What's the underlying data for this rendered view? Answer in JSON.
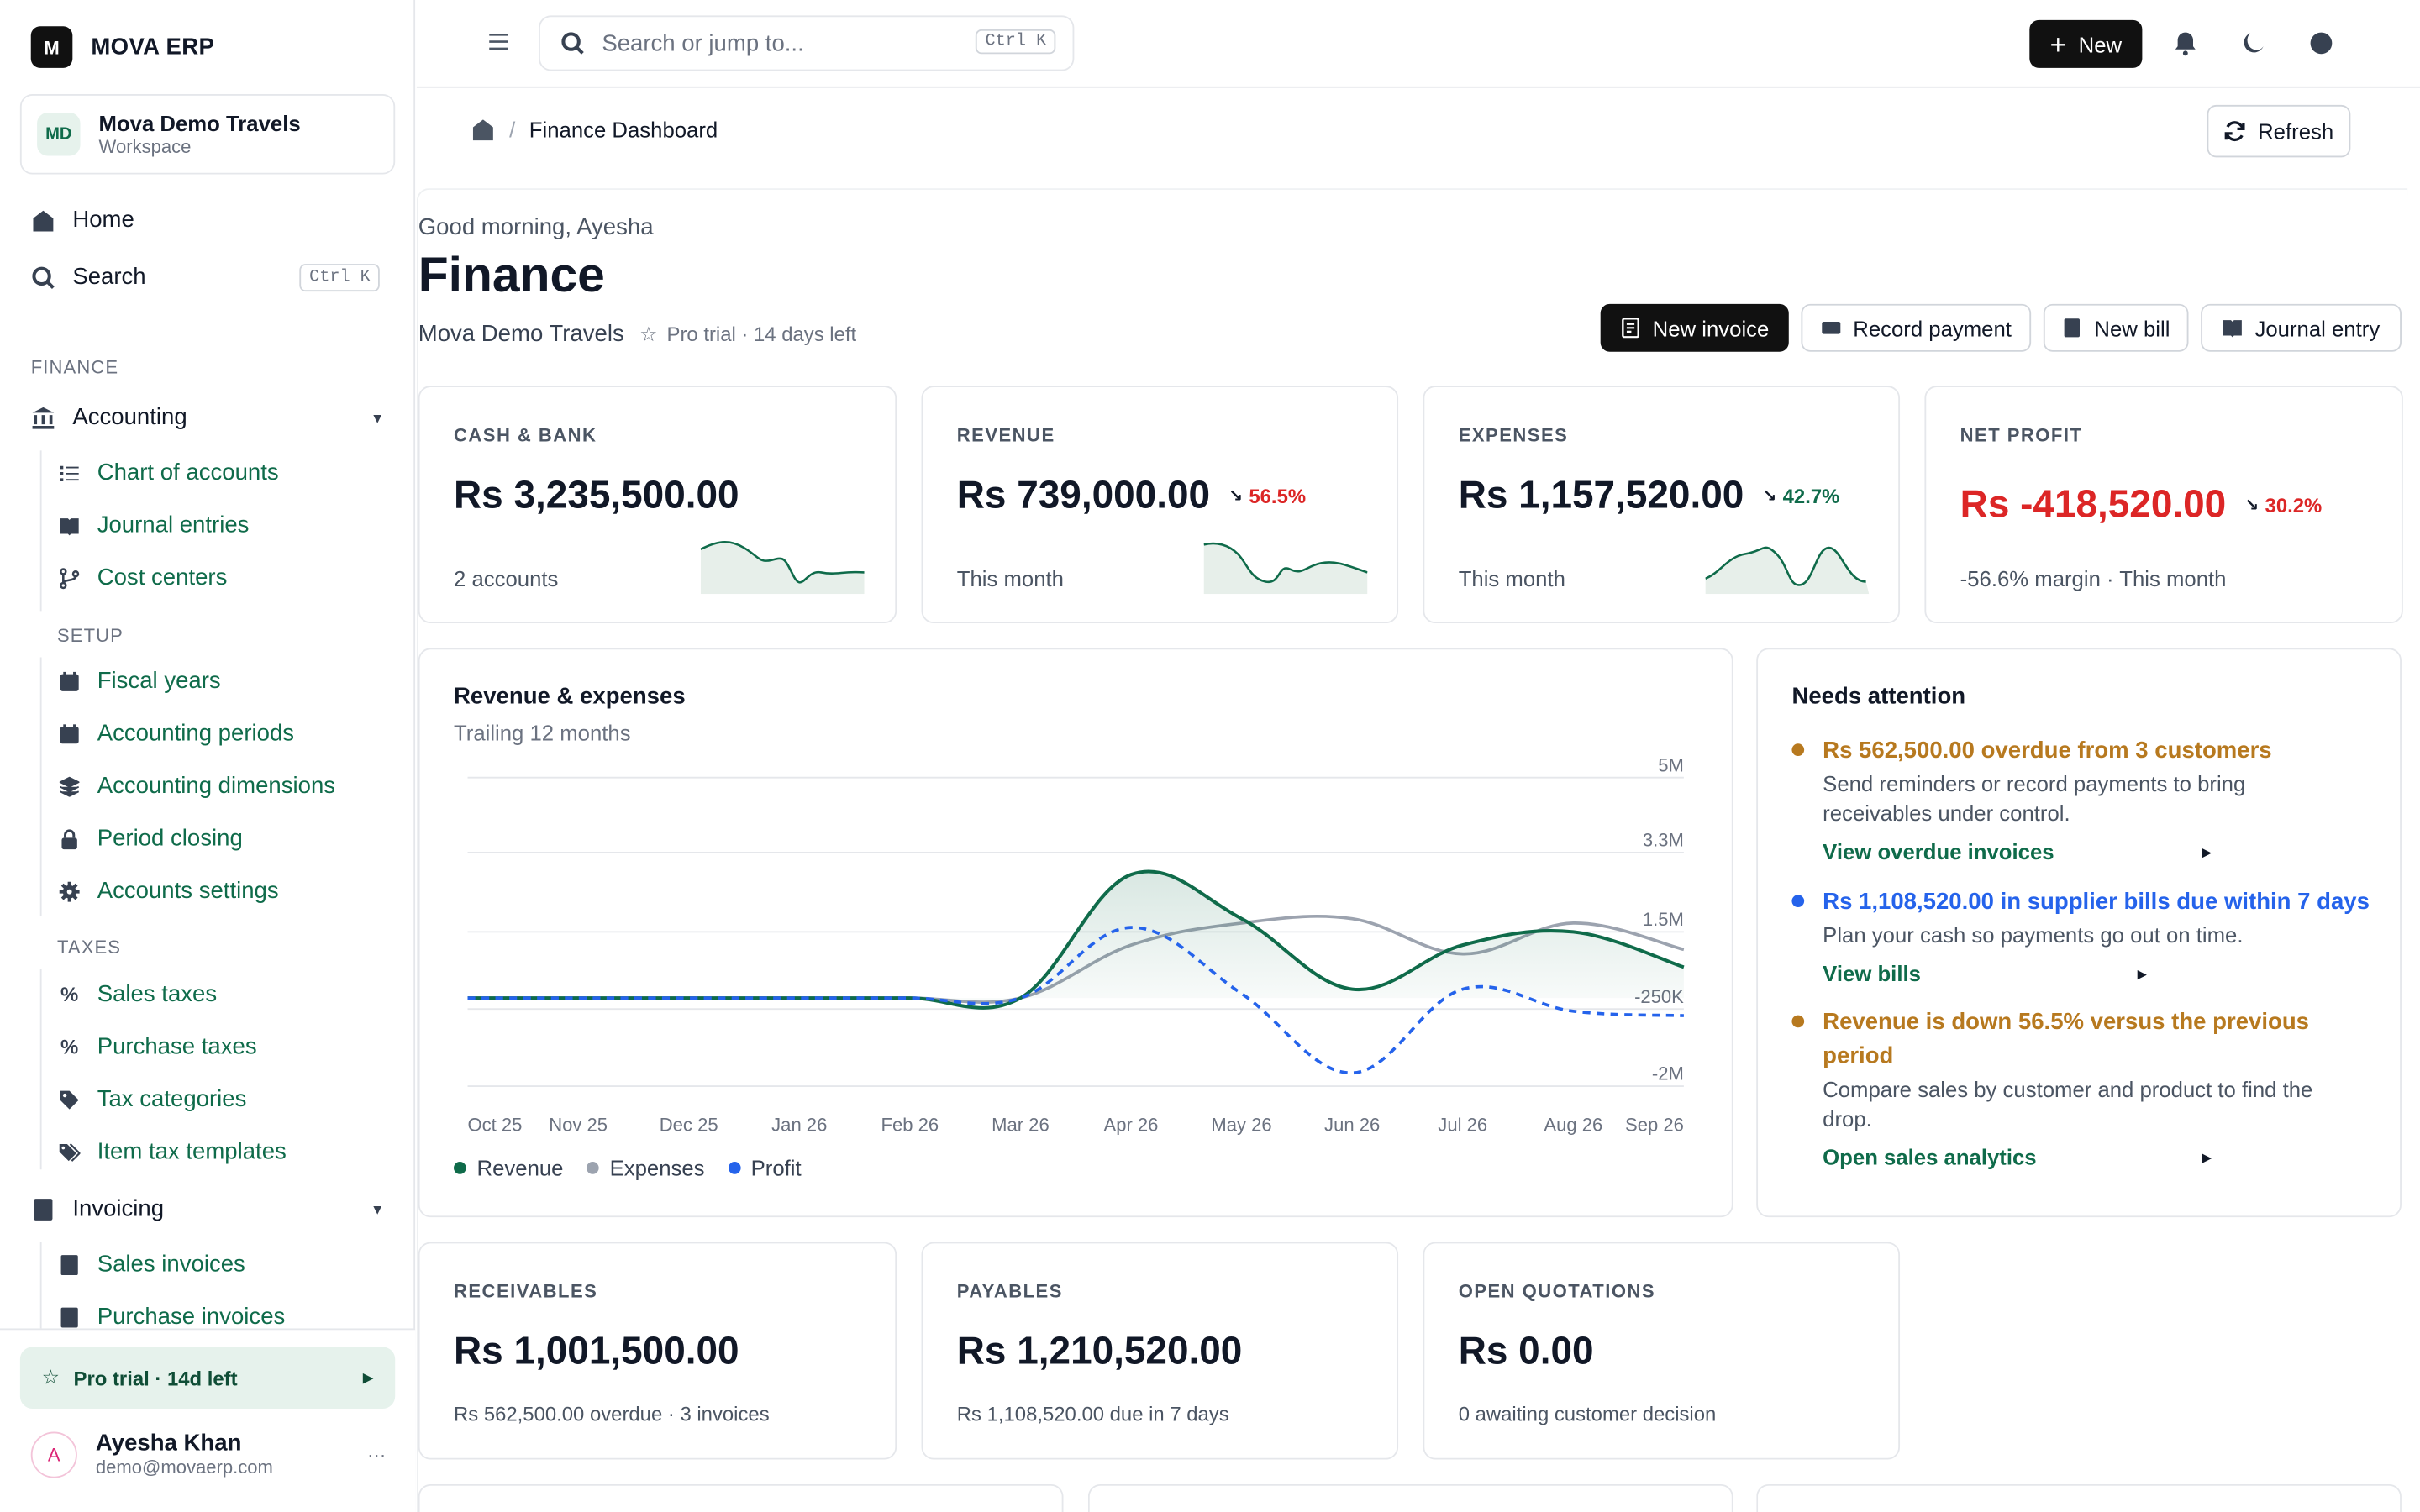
{
  "app": {
    "name": "MOVA ERP",
    "logo_letter": "M"
  },
  "workspace": {
    "initials": "MD",
    "name": "Mova Demo Travels",
    "subtitle": "Workspace"
  },
  "nav": {
    "home": "Home",
    "search": "Search",
    "search_shortcut": "Ctrl K",
    "section_finance": "FINANCE",
    "accounting": "Accounting",
    "accounting_items": [
      "Chart of accounts",
      "Journal entries",
      "Cost centers"
    ],
    "setup_label": "SETUP",
    "setup_items": [
      "Fiscal years",
      "Accounting periods",
      "Accounting dimensions",
      "Period closing",
      "Accounts settings"
    ],
    "taxes_label": "TAXES",
    "taxes_items": [
      "Sales taxes",
      "Purchase taxes",
      "Tax categories",
      "Item tax templates"
    ],
    "invoicing": "Invoicing",
    "invoicing_items": [
      "Sales invoices",
      "Purchase invoices"
    ]
  },
  "pro_trial": "Pro trial · 14d left",
  "user": {
    "initial": "A",
    "name": "Ayesha Khan",
    "email": "demo@movaerp.com",
    "more": "···"
  },
  "topbar": {
    "search_placeholder": "Search or jump to...",
    "search_shortcut": "Ctrl K",
    "new_label": "New"
  },
  "breadcrumb": {
    "current": "Finance Dashboard"
  },
  "refresh_label": "Refresh",
  "header": {
    "greeting": "Good morning, Ayesha",
    "title": "Finance",
    "workspace": "Mova Demo Travels",
    "trial": "Pro trial · 14 days left"
  },
  "actions": {
    "new_invoice": "New invoice",
    "record_payment": "Record payment",
    "new_bill": "New bill",
    "journal_entry": "Journal entry"
  },
  "kpis": [
    {
      "label": "CASH & BANK",
      "value": "Rs 3,235,500.00",
      "change": "",
      "sub": "2 accounts"
    },
    {
      "label": "REVENUE",
      "value": "Rs 739,000.00",
      "change": "56.5%",
      "change_dir": "down",
      "sub": "This month"
    },
    {
      "label": "EXPENSES",
      "value": "Rs 1,157,520.00",
      "change": "42.7%",
      "change_dir": "down",
      "sub": "This month"
    },
    {
      "label": "NET PROFIT",
      "value": "Rs -418,520.00",
      "change": "30.2%",
      "change_dir": "down",
      "sub": "-56.6% margin · This month"
    }
  ],
  "chart_data": {
    "type": "line",
    "title": "Revenue & expenses",
    "subtitle": "Trailing 12 months",
    "categories": [
      "Oct 25",
      "Nov 25",
      "Dec 25",
      "Jan 26",
      "Feb 26",
      "Mar 26",
      "Apr 26",
      "May 26",
      "Jun 26",
      "Jul 26",
      "Aug 26",
      "Sep 26"
    ],
    "y_ticks": [
      "5M",
      "3.3M",
      "1.5M",
      "-250K",
      "-2M"
    ],
    "ylim": [
      -2000000,
      5000000
    ],
    "series": [
      {
        "name": "Revenue",
        "color": "#0f6b4a",
        "values": [
          0,
          0,
          0,
          0,
          0,
          0,
          2800000,
          1800000,
          200000,
          1200000,
          1500000,
          700000
        ]
      },
      {
        "name": "Expenses",
        "color": "#9ca3af",
        "values": [
          0,
          0,
          0,
          0,
          0,
          0,
          1200000,
          1700000,
          1800000,
          1000000,
          1700000,
          1100000
        ]
      },
      {
        "name": "Profit",
        "color": "#2563eb",
        "values": [
          0,
          0,
          0,
          0,
          0,
          0,
          1600000,
          100000,
          -1700000,
          200000,
          -300000,
          -400000
        ]
      }
    ]
  },
  "needs_attention": {
    "title": "Needs attention",
    "items": [
      {
        "head": "Rs 562,500.00 overdue from 3 customers",
        "desc": "Send reminders or record payments to bring receivables under control.",
        "link": "View overdue invoices",
        "color": "#b7791f"
      },
      {
        "head": "Rs 1,108,520.00 in supplier bills due within 7 days",
        "desc": "Plan your cash so payments go out on time.",
        "link": "View bills",
        "color": "#2563eb"
      },
      {
        "head": "Revenue is down 56.5% versus the previous period",
        "desc": "Compare sales by customer and product to find the drop.",
        "link": "Open sales analytics",
        "color": "#b7791f"
      }
    ]
  },
  "bottom_kpis": [
    {
      "label": "RECEIVABLES",
      "value": "Rs 1,001,500.00",
      "sub": "Rs 562,500.00 overdue · 3 invoices"
    },
    {
      "label": "PAYABLES",
      "value": "Rs 1,210,520.00",
      "sub": "Rs 1,108,520.00 due in 7 days"
    },
    {
      "label": "OPEN QUOTATIONS",
      "value": "Rs 0.00",
      "sub": "0 awaiting customer decision"
    }
  ]
}
